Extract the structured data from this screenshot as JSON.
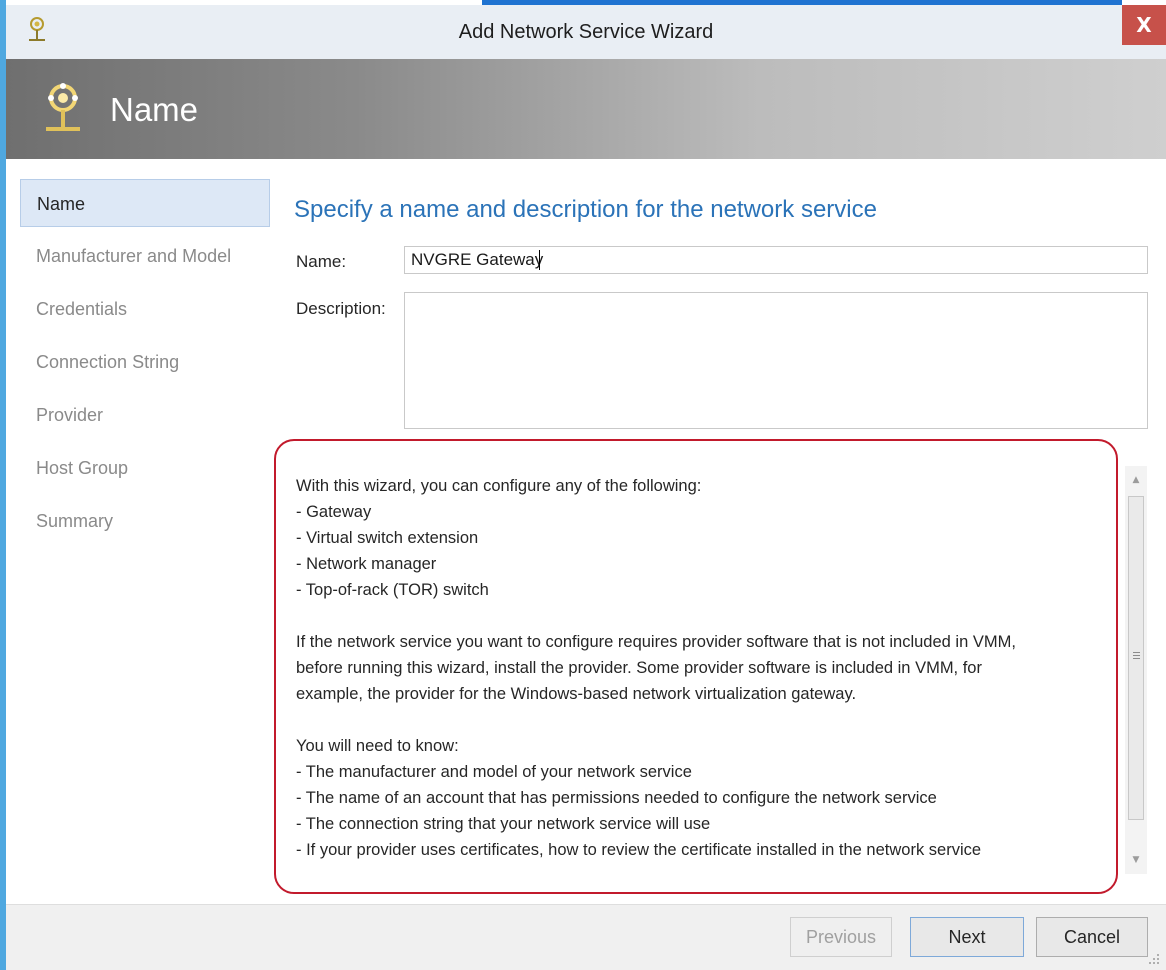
{
  "window": {
    "title": "Add Network Service Wizard",
    "close_glyph": "X"
  },
  "header": {
    "title": "Name",
    "icon": "network-service-icon"
  },
  "steps": [
    {
      "label": "Name",
      "active": true
    },
    {
      "label": "Manufacturer and Model",
      "active": false
    },
    {
      "label": "Credentials",
      "active": false
    },
    {
      "label": "Connection String",
      "active": false
    },
    {
      "label": "Provider",
      "active": false
    },
    {
      "label": "Host Group",
      "active": false
    },
    {
      "label": "Summary",
      "active": false
    }
  ],
  "main": {
    "heading": "Specify a name and description for the network service",
    "name_label": "Name:",
    "name_value": "NVGRE Gateway",
    "description_label": "Description:",
    "description_value": ""
  },
  "info": {
    "intro": "With this wizard, you can configure any of the following:",
    "options": [
      "- Gateway",
      "- Virtual switch extension",
      "- Network manager",
      "- Top-of-rack (TOR) switch"
    ],
    "provider_lines": [
      "If the network service you want to configure requires provider software that is not included in VMM,",
      "before running this wizard, install the provider. Some provider software is included in VMM, for",
      "example, the provider for the Windows-based network virtualization gateway."
    ],
    "know_heading": "You will need to know:",
    "know_items": [
      "- The manufacturer and model of your network service",
      "- The name of an account that has permissions needed to configure the network service",
      "- The connection string that your network service will use",
      "- If your provider uses certificates, how to review the certificate installed in the network service"
    ]
  },
  "footer": {
    "previous_label": "Previous",
    "next_label": "Next",
    "cancel_label": "Cancel"
  },
  "colors": {
    "accent_blue": "#2b73b8",
    "highlight_border": "#c21a2c",
    "close_red": "#c7514a",
    "active_step_bg": "#dde8f6"
  }
}
